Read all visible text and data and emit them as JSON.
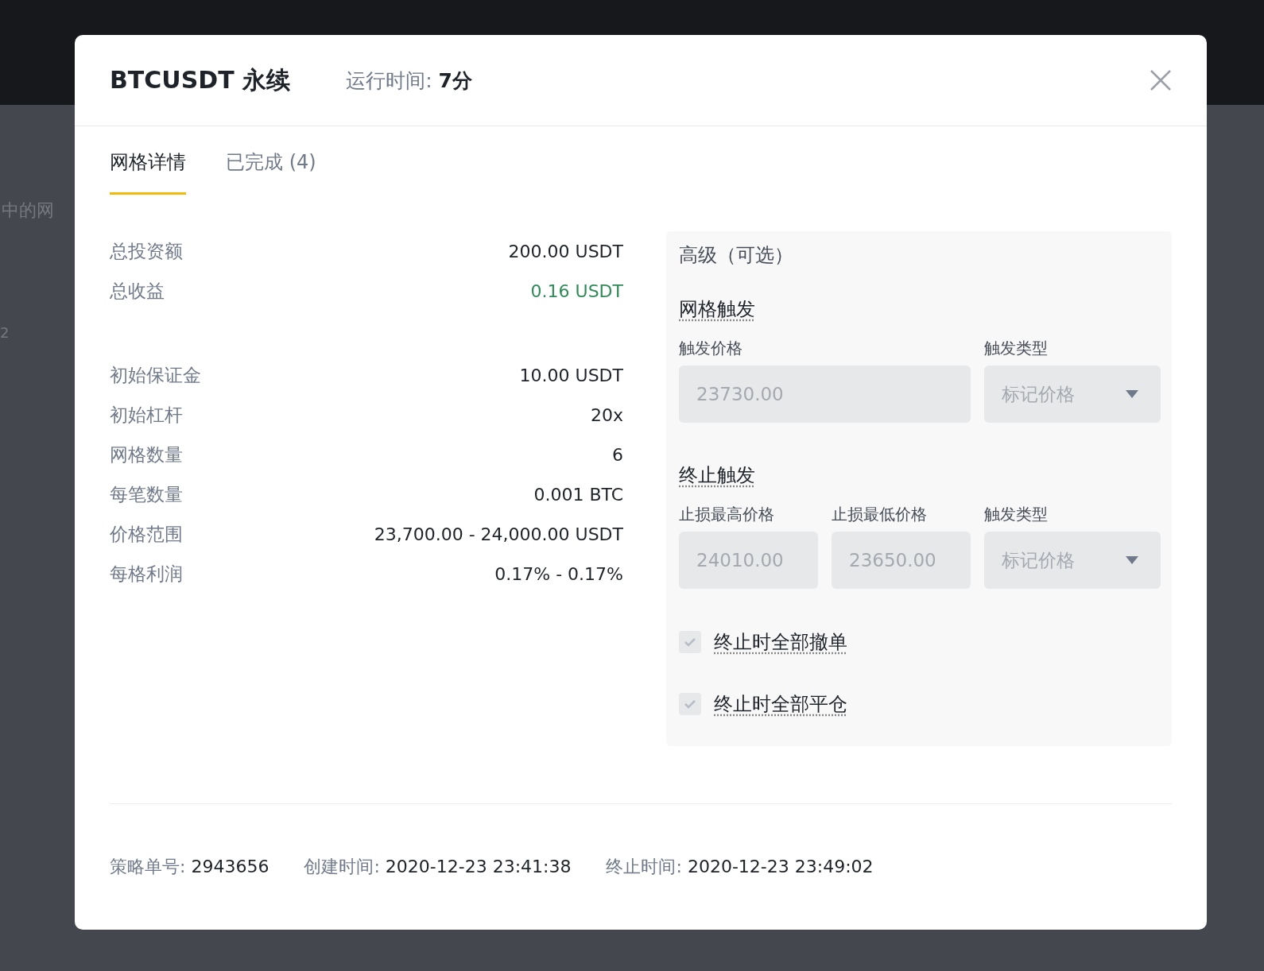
{
  "background": {
    "side_text": "中的网",
    "side_number": "2"
  },
  "dialog": {
    "title": "BTCUSDT 永续",
    "runtime_label": "运行时间:",
    "runtime_value": "7分"
  },
  "tabs": [
    {
      "label": "网格详情",
      "selected": true
    },
    {
      "label": "已完成 (4)",
      "selected": false
    }
  ],
  "summary": [
    {
      "label": "总投资额",
      "value": "200.00 USDT",
      "kind": "plain"
    },
    {
      "label": "总收益",
      "value": "0.16 USDT",
      "kind": "profit"
    }
  ],
  "parameters": [
    {
      "label": "初始保证金",
      "value": "10.00 USDT",
      "kind": "plain"
    },
    {
      "label": "初始杠杆",
      "value": "20x",
      "kind": "plain"
    },
    {
      "label": "网格数量",
      "value": "6",
      "kind": "plain"
    },
    {
      "label": "每笔数量",
      "value": "0.001 BTC",
      "kind": "plain"
    },
    {
      "label": "价格范围",
      "value": "23,700.00 - 24,000.00 USDT",
      "kind": "plain"
    },
    {
      "label": "每格利润",
      "value": "0.17% - 0.17%",
      "kind": "plain"
    }
  ],
  "advanced": {
    "title": "高级（可选）",
    "sections": [
      {
        "title": "网格触发",
        "fields": [
          {
            "label": "触发价格",
            "value": "23730.00",
            "kind": "input",
            "disabled": true
          },
          {
            "label": "触发类型",
            "value": "标记价格",
            "kind": "select",
            "disabled": true
          }
        ]
      },
      {
        "title": "终止触发",
        "fields": [
          {
            "label": "止损最高价格",
            "value": "24010.00",
            "kind": "input",
            "disabled": true
          },
          {
            "label": "止损最低价格",
            "value": "23650.00",
            "kind": "input",
            "disabled": true
          },
          {
            "label": "触发类型",
            "value": "标记价格",
            "kind": "select",
            "disabled": true
          }
        ]
      }
    ],
    "options": [
      {
        "label": "终止时全部撤单",
        "checked": true
      },
      {
        "label": "终止时全部平仓",
        "checked": true
      }
    ]
  },
  "footer": [
    {
      "label": "策略单号:",
      "value": "2943656"
    },
    {
      "label": "创建时间:",
      "value": "2020-12-23 23:41:38"
    },
    {
      "label": "终止时间:",
      "value": "2020-12-23 23:49:02"
    }
  ]
}
